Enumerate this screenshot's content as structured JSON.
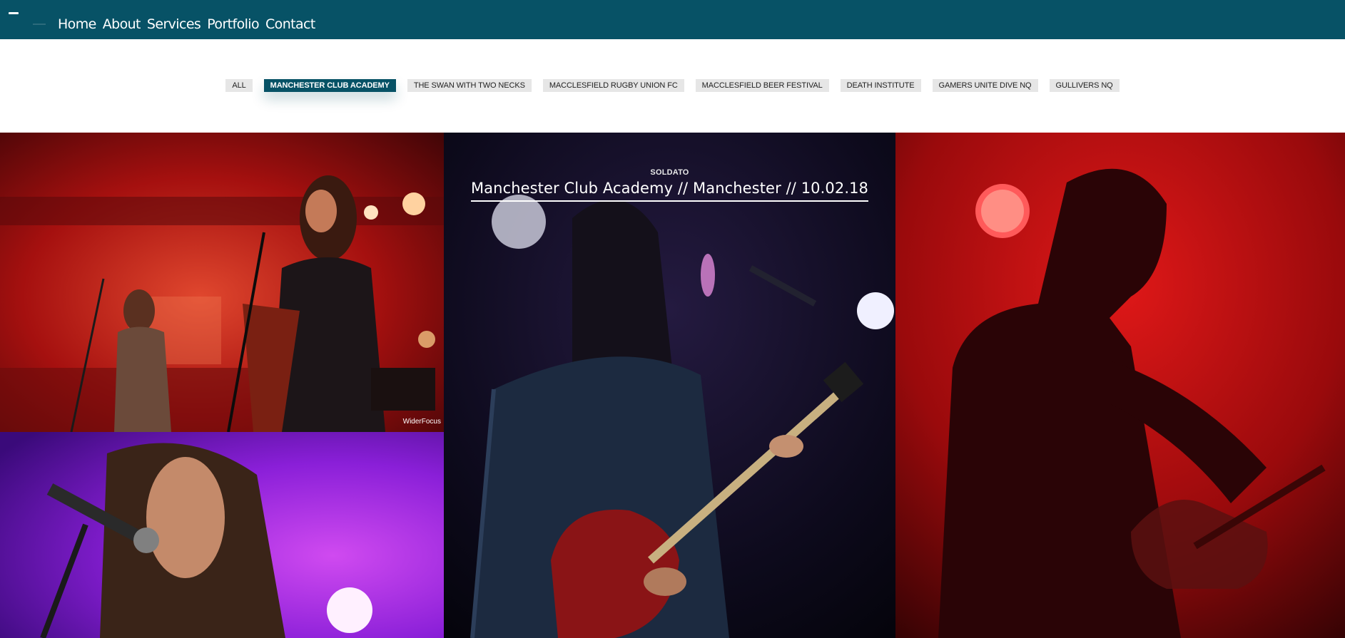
{
  "nav": {
    "items": [
      {
        "label": "Home"
      },
      {
        "label": "About"
      },
      {
        "label": "Services"
      },
      {
        "label": "Portfolio"
      },
      {
        "label": "Contact"
      }
    ]
  },
  "filters": {
    "items": [
      {
        "label": "ALL"
      },
      {
        "label": "MANCHESTER CLUB ACADEMY"
      },
      {
        "label": "THE SWAN WITH TWO NECKS"
      },
      {
        "label": "MACCLESFIELD RUGBY UNION FC"
      },
      {
        "label": "MACCLESFIELD BEER FESTIVAL"
      },
      {
        "label": "DEATH INSTITUTE"
      },
      {
        "label": "GAMERS UNITE DIVE NQ"
      },
      {
        "label": "GULLIVERS NQ"
      }
    ],
    "active": "MANCHESTER CLUB ACADEMY"
  },
  "gallery": {
    "hover_overlay": {
      "artist": "SOLDATO",
      "title": "Manchester Club Academy // Manchester // 10.02.18"
    },
    "watermark": "WiderFocus"
  },
  "colors": {
    "brand": "#075266",
    "filter_bg": "#e6e6e6",
    "stage_red": "#c8141a",
    "stage_purple": "#8a1fd8"
  }
}
